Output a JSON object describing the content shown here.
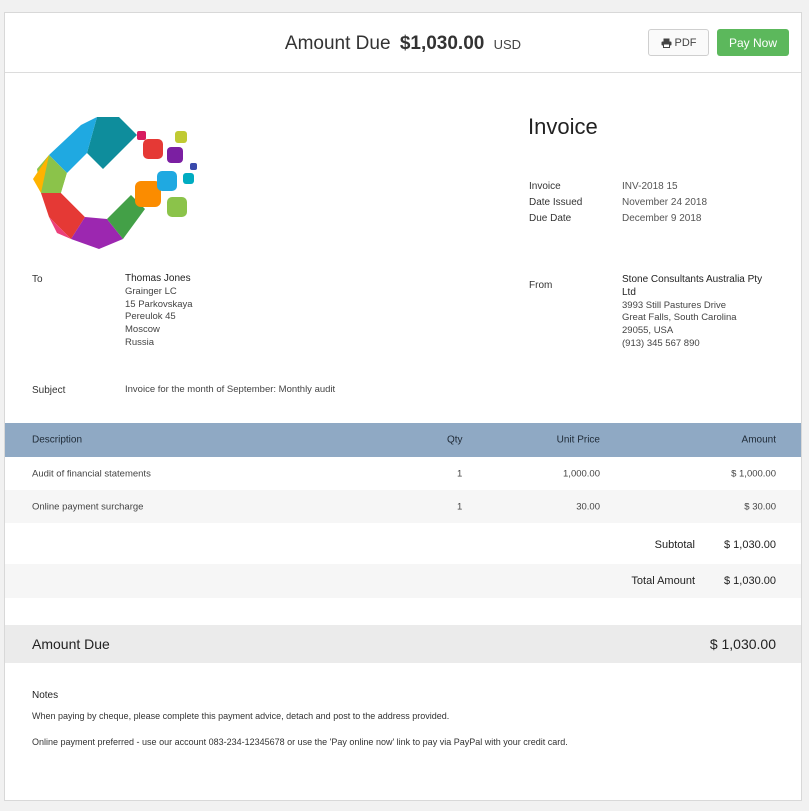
{
  "header": {
    "label": "Amount Due",
    "amount": "$1,030.00",
    "currency": "USD",
    "pdf_label": "PDF",
    "pay_label": "Pay Now",
    "accent": "#5cb85c"
  },
  "invoice": {
    "title": "Invoice",
    "meta": [
      {
        "label": "Invoice",
        "value": "INV-2018 15"
      },
      {
        "label": "Date Issued",
        "value": "November 24 2018"
      },
      {
        "label": "Due Date",
        "value": "December 9 2018"
      }
    ]
  },
  "to": {
    "label": "To",
    "name": "Thomas Jones",
    "lines": [
      "Grainger LC",
      "15 Parkovskaya",
      "Pereulok 45",
      "Moscow",
      "Russia"
    ]
  },
  "from": {
    "label": "From",
    "name_line1": "Stone Consultants Australia Pty",
    "name_line2": "Ltd",
    "lines": [
      "3993 Still Pastures Drive",
      "Great Falls, South Carolina",
      "29055, USA",
      "(913) 345 567 890"
    ]
  },
  "subject": {
    "label": "Subject",
    "value": "Invoice for the month of September: Monthly audit"
  },
  "table": {
    "headers": {
      "description": "Description",
      "qty": "Qty",
      "unit_price": "Unit Price",
      "amount": "Amount"
    },
    "header_color": "#8fa9c4",
    "rows": [
      {
        "description": "Audit of financial statements",
        "qty": "1",
        "unit_price": "1,000.00",
        "amount": "$ 1,000.00"
      },
      {
        "description": "Online payment surcharge",
        "qty": "1",
        "unit_price": "30.00",
        "amount": "$ 30.00"
      }
    ]
  },
  "totals": {
    "subtotal_label": "Subtotal",
    "subtotal_value": "$ 1,030.00",
    "total_label": "Total Amount",
    "total_value": "$ 1,030.00"
  },
  "amount_due": {
    "label": "Amount Due",
    "value": "$ 1,030.00"
  },
  "notes": {
    "title": "Notes",
    "line1": "When paying by cheque, please complete this payment advice, detach and post to the address provided.",
    "line2": "Online payment preferred - use our account 083-234-12345678 or use the 'Pay online now' link to pay via PayPal with your credit card."
  }
}
